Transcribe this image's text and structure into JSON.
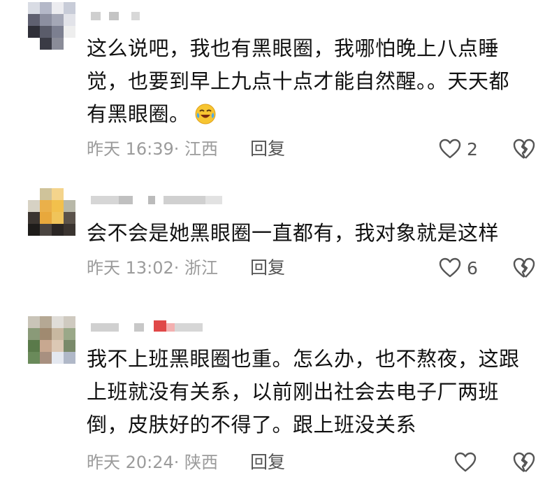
{
  "comments": [
    {
      "lines": [
        "这么说吧，我也有黑眼圈，我哪怕晚上八点睡",
        "觉，也要到早上九点十点才能自然醒。。天天都",
        "有黑眼圈。"
      ],
      "emoji": "laughing-crying-emoji",
      "time": "昨天 16:39",
      "location": "江西",
      "meta": "昨天 16:39· 江西",
      "reply_label": "回复",
      "likes": "2"
    },
    {
      "lines": [
        "会不会是她黑眼圈一直都有，我对象就是这样"
      ],
      "time": "昨天 13:02",
      "location": "浙江",
      "meta": "昨天 13:02· 浙江",
      "reply_label": "回复",
      "likes": "6"
    },
    {
      "lines": [
        "我不上班黑眼圈也重。怎么办，也不熬夜，这跟",
        "上班就没有关系，以前刚出社会去电子厂两班",
        "倒，皮肤好的不得了。跟上班没关系"
      ],
      "time": "昨天 20:24",
      "location": "陕西",
      "meta": "昨天 20:24· 陕西",
      "reply_label": "回复",
      "likes": ""
    }
  ],
  "icons": {
    "like": "heart-outline-icon",
    "dislike": "broken-heart-icon"
  },
  "colors": {
    "text": "#111111",
    "meta": "#9b9b9b",
    "icon": "#555555"
  }
}
